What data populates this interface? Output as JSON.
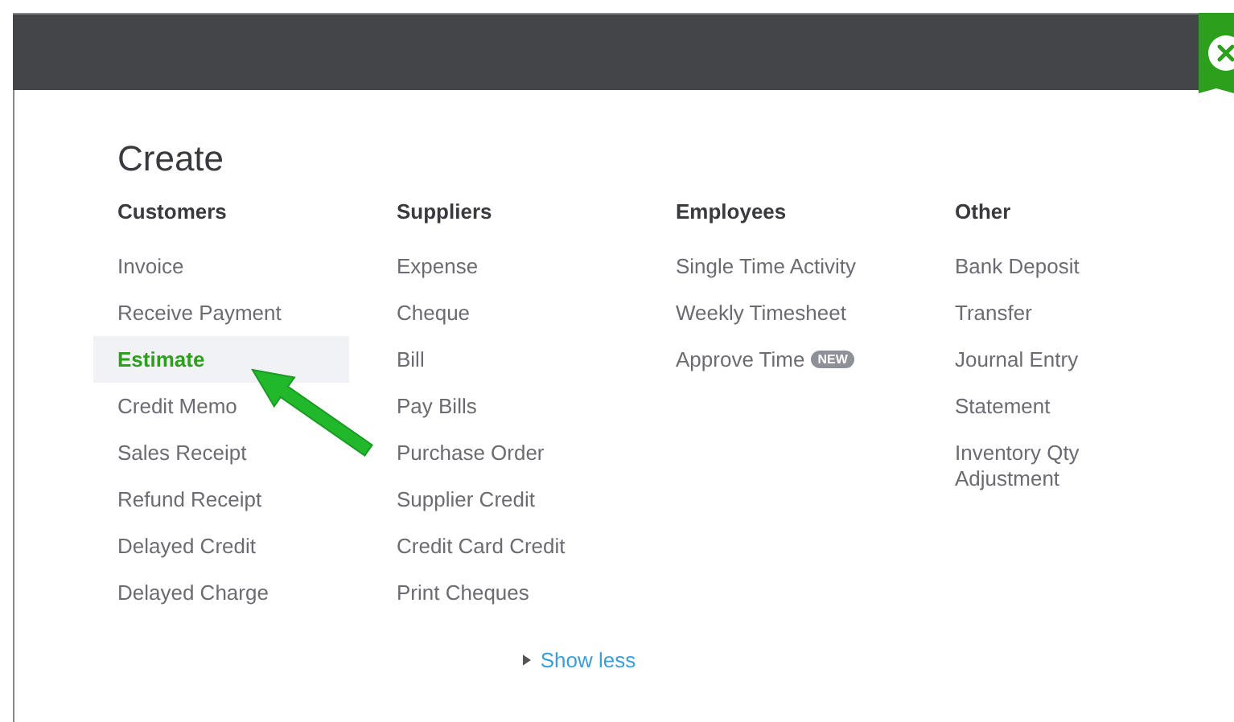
{
  "title": "Create",
  "columns": [
    {
      "heading": "Customers",
      "items": [
        {
          "label": "Invoice",
          "selected": false
        },
        {
          "label": "Receive Payment",
          "selected": false
        },
        {
          "label": "Estimate",
          "selected": true
        },
        {
          "label": "Credit Memo",
          "selected": false
        },
        {
          "label": "Sales Receipt",
          "selected": false
        },
        {
          "label": "Refund Receipt",
          "selected": false
        },
        {
          "label": "Delayed Credit",
          "selected": false
        },
        {
          "label": "Delayed Charge",
          "selected": false
        }
      ]
    },
    {
      "heading": "Suppliers",
      "items": [
        {
          "label": "Expense",
          "selected": false
        },
        {
          "label": "Cheque",
          "selected": false
        },
        {
          "label": "Bill",
          "selected": false
        },
        {
          "label": "Pay Bills",
          "selected": false
        },
        {
          "label": "Purchase Order",
          "selected": false
        },
        {
          "label": "Supplier Credit",
          "selected": false
        },
        {
          "label": "Credit Card Credit",
          "selected": false
        },
        {
          "label": "Print Cheques",
          "selected": false
        }
      ]
    },
    {
      "heading": "Employees",
      "items": [
        {
          "label": "Single Time Activity",
          "selected": false
        },
        {
          "label": "Weekly Timesheet",
          "selected": false
        },
        {
          "label": "Approve Time",
          "selected": false,
          "badge": "NEW"
        }
      ]
    },
    {
      "heading": "Other",
      "items": [
        {
          "label": "Bank Deposit",
          "selected": false
        },
        {
          "label": "Transfer",
          "selected": false
        },
        {
          "label": "Journal Entry",
          "selected": false
        },
        {
          "label": "Statement",
          "selected": false
        },
        {
          "label": "Inventory Qty Adjustment",
          "selected": false
        }
      ]
    }
  ],
  "toggle": {
    "label": "Show less",
    "expanded": true
  }
}
